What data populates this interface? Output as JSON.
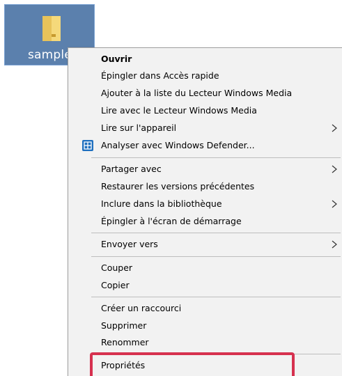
{
  "desktop_icon": {
    "label": "sample",
    "icon": "folder-icon"
  },
  "context_menu": {
    "items": [
      {
        "label": "Ouvrir",
        "bold": true
      },
      {
        "label": "Épingler dans Accès rapide"
      },
      {
        "label": "Ajouter à la liste du Lecteur Windows Media"
      },
      {
        "label": "Lire avec le Lecteur Windows Media"
      },
      {
        "label": "Lire sur l'appareil",
        "submenu": true
      },
      {
        "label": "Analyser avec Windows Defender...",
        "icon": "windows-defender-icon"
      },
      {
        "label": "Partager avec",
        "submenu": true
      },
      {
        "label": "Restaurer les versions précédentes"
      },
      {
        "label": "Inclure dans la bibliothèque",
        "submenu": true
      },
      {
        "label": "Épingler à l'écran de démarrage"
      },
      {
        "label": "Envoyer vers",
        "submenu": true
      },
      {
        "label": "Couper"
      },
      {
        "label": "Copier"
      },
      {
        "label": "Créer un raccourci"
      },
      {
        "label": "Supprimer"
      },
      {
        "label": "Renommer"
      },
      {
        "label": "Propriétés",
        "highlighted": true
      }
    ]
  },
  "colors": {
    "menu_background": "#f2f2f2",
    "highlight_border": "#d6314f",
    "desktop_selection": "#5b80ad"
  }
}
